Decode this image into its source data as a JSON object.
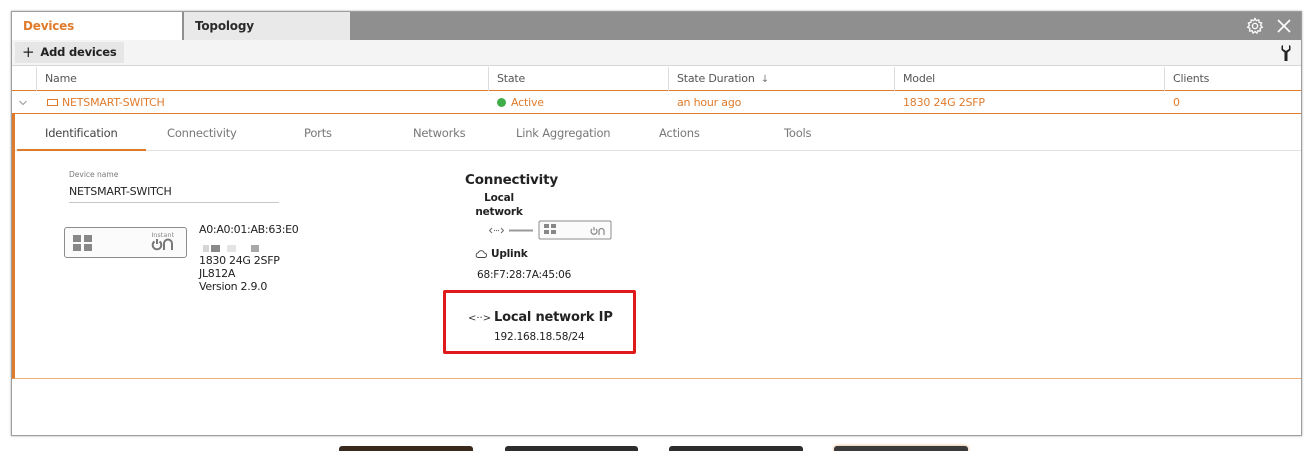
{
  "tabs": {
    "devices": "Devices",
    "topology": "Topology"
  },
  "toolbar": {
    "add_plus": "+",
    "add_devices": "Add devices"
  },
  "table": {
    "columns": [
      "Name",
      "State",
      "State Duration",
      "Model",
      "Clients"
    ],
    "sort_indicator": "↓",
    "row": {
      "name": "NETSMART-SWITCH",
      "state": "Active",
      "state_duration": "an hour ago",
      "model": "1830 24G 2SFP",
      "clients": "0"
    }
  },
  "detail_tabs": [
    "Identification",
    "Connectivity",
    "Ports",
    "Networks",
    "Link Aggregation",
    "Actions",
    "Tools"
  ],
  "identification": {
    "device_name_label": "Device name",
    "device_name": "NETSMART-SWITCH",
    "device_brand": "Instant",
    "mac": "A0:A0:01:AB:63:E0",
    "model": "1830 24G 2SFP",
    "sku": "JL812A",
    "version": "Version 2.9.0"
  },
  "connectivity": {
    "title": "Connectivity",
    "local_network_label": "Local network",
    "uplink_label": "Uplink",
    "uplink_mac": "68:F7:28:7A:45:06",
    "local_ip_title": "Local network IP",
    "local_ip_value": "192.168.18.58/24",
    "local_ip_icon": "<··>"
  },
  "colors": {
    "accent": "#e07b2c",
    "active": "#3fae49",
    "highlight": "#e01a1a"
  },
  "icons": [
    "gear-icon",
    "close-icon",
    "wrench-icon",
    "chevron-down-icon",
    "switch-icon",
    "cloud-icon",
    "network-icon"
  ]
}
